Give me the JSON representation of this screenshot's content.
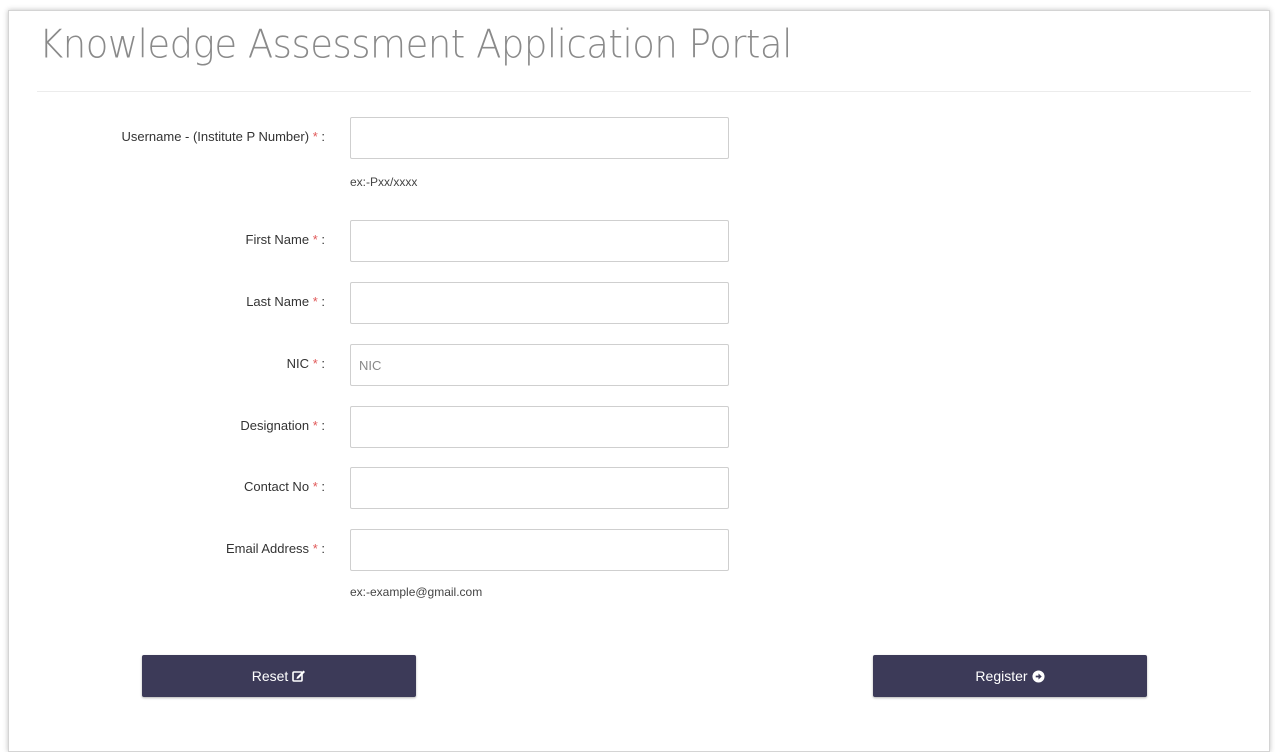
{
  "page": {
    "title": "Knowledge Assessment Application Portal"
  },
  "form": {
    "required_mark": "*",
    "colon": ":",
    "fields": [
      {
        "label": "Username - (Institute P Number)",
        "value": "",
        "placeholder": "",
        "hint": "ex:-Pxx/xxxx"
      },
      {
        "label": "First Name",
        "value": "",
        "placeholder": ""
      },
      {
        "label": "Last Name",
        "value": "",
        "placeholder": ""
      },
      {
        "label": "NIC",
        "value": "",
        "placeholder": "NIC"
      },
      {
        "label": "Designation",
        "value": "",
        "placeholder": ""
      },
      {
        "label": "Contact No",
        "value": "",
        "placeholder": ""
      },
      {
        "label": "Email Address",
        "value": "",
        "placeholder": "",
        "hint": "ex:-example@gmail.com"
      }
    ]
  },
  "buttons": {
    "reset_label": "Reset",
    "reset_icon": "edit-icon",
    "register_label": "Register",
    "register_icon": "arrow-circle-right-icon",
    "color": "#3c3a58"
  },
  "colors": {
    "required": "#e05858",
    "title": "#8a8a8a"
  }
}
